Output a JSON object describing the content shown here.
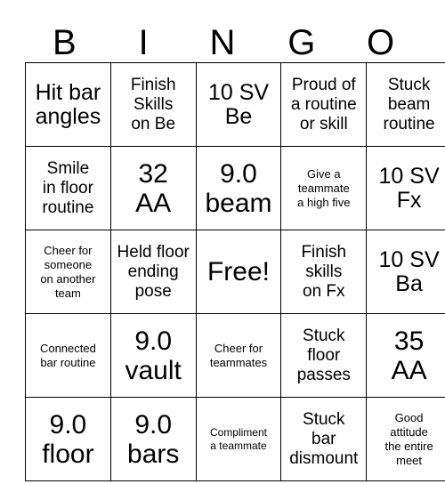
{
  "card": {
    "title": "BINGO",
    "header_letters": [
      "B",
      "I",
      "N",
      "G",
      "O"
    ],
    "free_space": "Free!",
    "colors": {
      "background": "#ffffff",
      "text": "#000000",
      "border": "#000000"
    },
    "rows": [
      [
        {
          "text": "Hit bar\nangles",
          "size": "lg"
        },
        {
          "text": "Finish\nSkills\non Be",
          "size": "md"
        },
        {
          "text": "10 SV\nBe",
          "size": "lg"
        },
        {
          "text": "Proud of\na routine\nor skill",
          "size": "md"
        },
        {
          "text": "Stuck\nbeam\nroutine",
          "size": "md"
        }
      ],
      [
        {
          "text": "Smile\nin floor\nroutine",
          "size": "md"
        },
        {
          "text": "32\nAA",
          "size": "xl"
        },
        {
          "text": "9.0\nbeam",
          "size": "xl"
        },
        {
          "text": "Give a\nteammate\na high five",
          "size": "sm"
        },
        {
          "text": "10 SV\nFx",
          "size": "lg"
        }
      ],
      [
        {
          "text": "Cheer for\nsomeone\non another\nteam",
          "size": "sm"
        },
        {
          "text": "Held floor\nending\npose",
          "size": "md"
        },
        {
          "text": "Free!",
          "size": "xl"
        },
        {
          "text": "Finish\nskills\non Fx",
          "size": "md"
        },
        {
          "text": "10 SV\nBa",
          "size": "lg"
        }
      ],
      [
        {
          "text": "Connected\nbar routine",
          "size": "sm"
        },
        {
          "text": "9.0\nvault",
          "size": "xl"
        },
        {
          "text": "Cheer for\nteammates",
          "size": "sm"
        },
        {
          "text": "Stuck\nfloor\npasses",
          "size": "md"
        },
        {
          "text": "35\nAA",
          "size": "xl"
        }
      ],
      [
        {
          "text": "9.0\nfloor",
          "size": "xl"
        },
        {
          "text": "9.0\nbars",
          "size": "xl"
        },
        {
          "text": "Compliment\na teammate",
          "size": "xs"
        },
        {
          "text": "Stuck\nbar\ndismount",
          "size": "md"
        },
        {
          "text": "Good\nattitude\nthe entire\nmeet",
          "size": "sm"
        }
      ]
    ]
  }
}
